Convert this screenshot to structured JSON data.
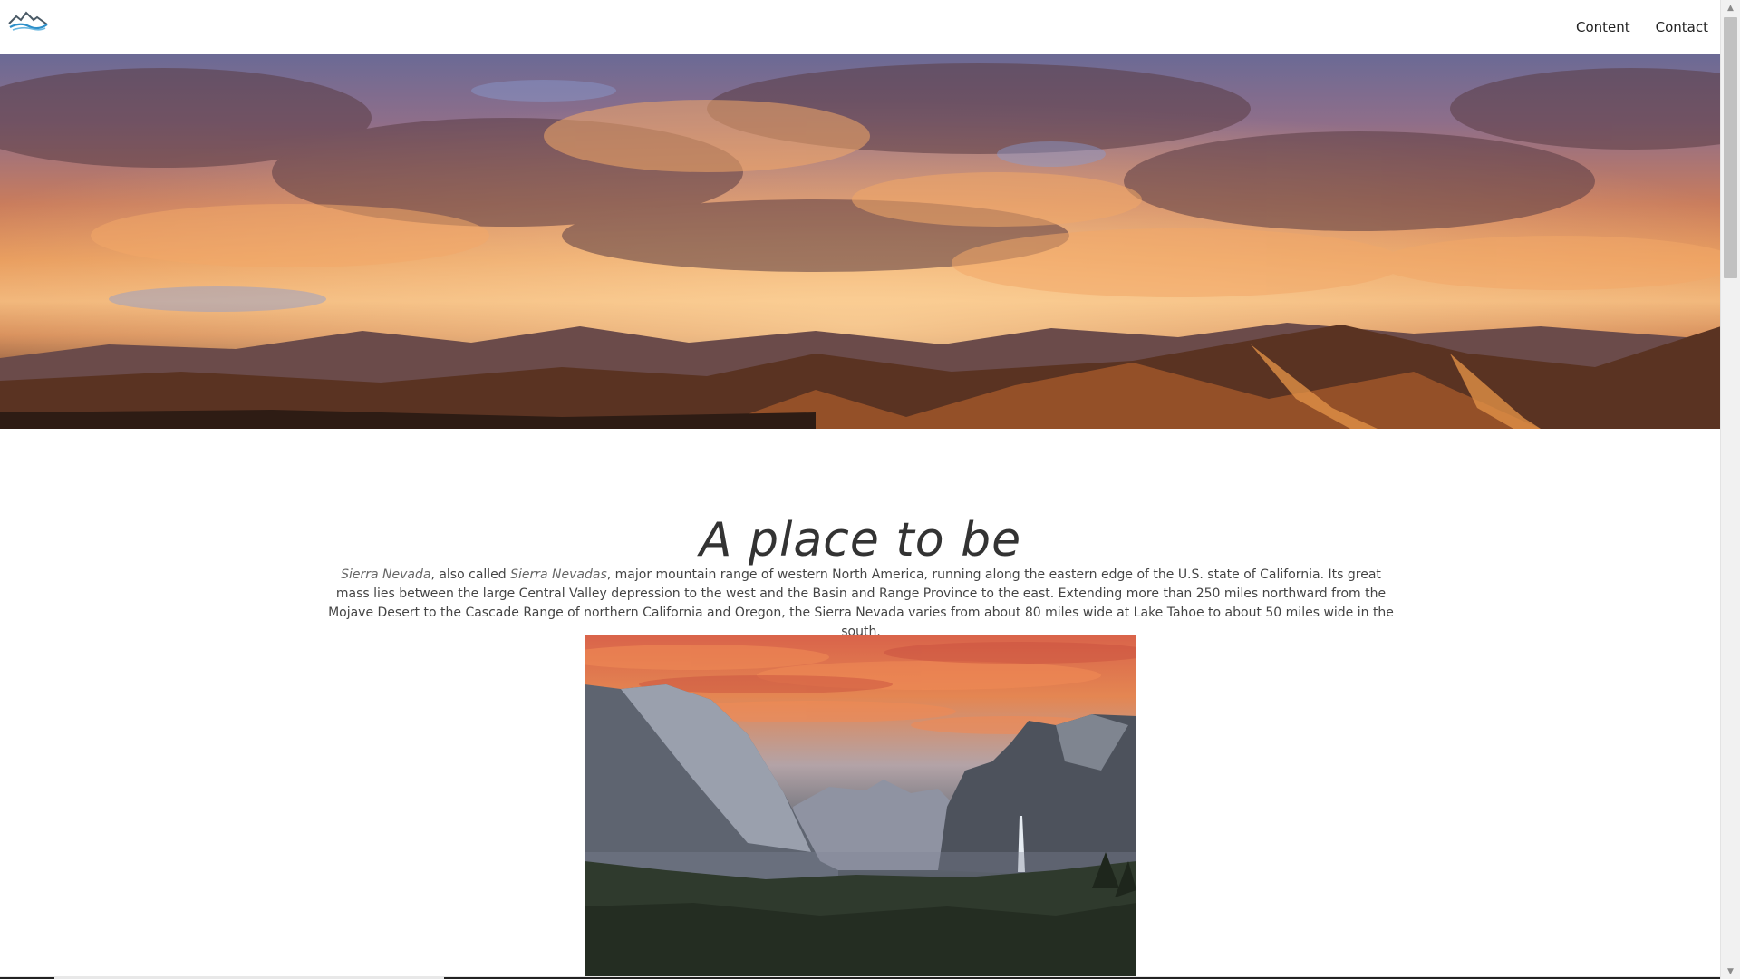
{
  "header": {
    "logo_icon": "mountain-logo-icon",
    "nav": [
      {
        "label": "Content"
      },
      {
        "label": "Contact"
      }
    ]
  },
  "hero": {
    "image": "sunset-mountain-range-banner"
  },
  "main": {
    "headline": "A place to be",
    "intro": {
      "term1": "Sierra Nevada",
      "mid1": ", also called ",
      "term2": "Sierra Nevadas",
      "rest": ", major mountain range of western North America, running along the eastern edge of the U.S. state of California. Its great mass lies between the large Central Valley depression to the west and the Basin and Range Province to the east. Extending more than 250 miles northward from the Mojave Desert to the Cascade Range of northern California and Oregon, the Sierra Nevada varies from about 80 miles wide at Lake Tahoe to about 50 miles wide in the south."
    },
    "photo": {
      "image": "yosemite-valley-sunset-photo"
    }
  },
  "scrollbar": {
    "up_icon": "▲",
    "down_icon": "▼"
  },
  "colors": {
    "header_bg": "#ffffff",
    "text": "#444444",
    "scroll_thumb": "#c1c1c1"
  }
}
